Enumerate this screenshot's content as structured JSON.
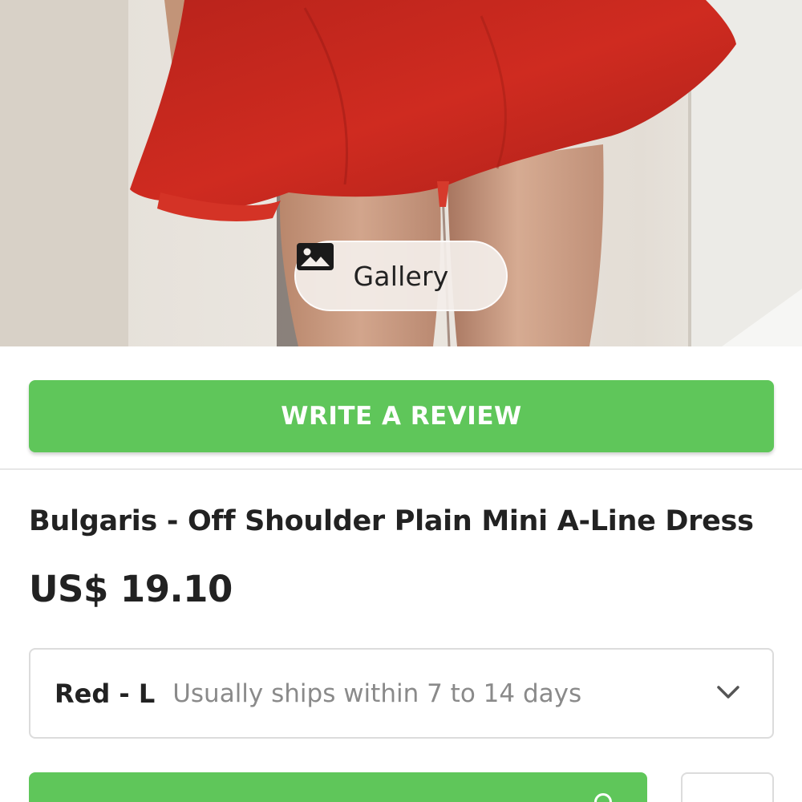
{
  "gallery": {
    "label": "Gallery",
    "icon": "image-icon"
  },
  "review": {
    "label": "WRITE A REVIEW"
  },
  "product": {
    "title": "Bulgaris - Off Shoulder Plain Mini A-Line Dress",
    "price": "US$ 19.10",
    "image": {
      "description_colors": {
        "dress": "#c9261e",
        "wall": "#e8e3dc",
        "skin": "#c99b82"
      }
    }
  },
  "variant": {
    "selected": "Red - L",
    "shipping": "Usually ships within 7 to 14 days",
    "icon": "chevron-down-icon"
  },
  "colors": {
    "accent_green": "#5fc65a",
    "text_dark": "#222222",
    "text_muted": "#8a8a8a",
    "border": "#dcdcdc"
  }
}
